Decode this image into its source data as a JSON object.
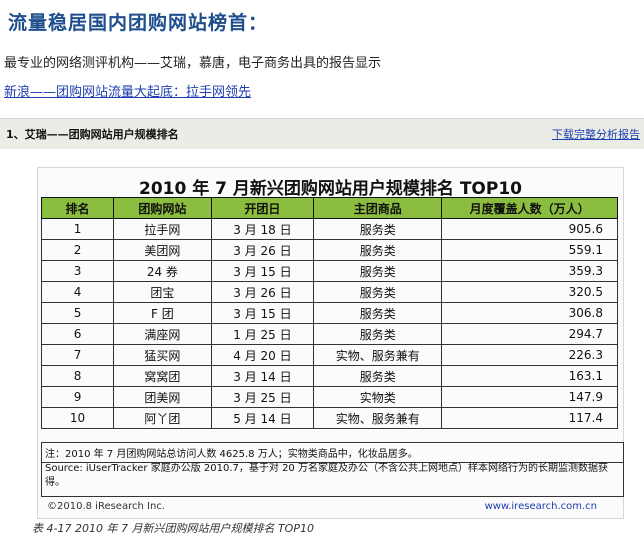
{
  "page": {
    "title": "流量稳居国内团购网站榜首：",
    "subtitle": "最专业的网络测评机构——艾瑞，慕唐，电子商务出具的报告显示",
    "link": "新浪——团购网站流量大起底：拉手网领先"
  },
  "section": {
    "title": "1、艾瑞——团购网站用户规模排名",
    "download_link": "下载完整分析报告"
  },
  "figure": {
    "title": "2010 年 7 月新兴团购网站用户规模排名 TOP10",
    "headers": [
      "排名",
      "团购网站",
      "开团日",
      "主团商品",
      "月度覆盖人数（万人）"
    ],
    "rows": [
      [
        "1",
        "拉手网",
        "3 月 18 日",
        "服务类",
        "905.6"
      ],
      [
        "2",
        "美团网",
        "3 月 26 日",
        "服务类",
        "559.1"
      ],
      [
        "3",
        "24 券",
        "3 月 15 日",
        "服务类",
        "359.3"
      ],
      [
        "4",
        "团宝",
        "3 月 26 日",
        "服务类",
        "320.5"
      ],
      [
        "5",
        "F 团",
        "3 月 15 日",
        "服务类",
        "306.8"
      ],
      [
        "6",
        "满座网",
        "1 月 25 日",
        "服务类",
        "294.7"
      ],
      [
        "7",
        "猛买网",
        "4 月 20 日",
        "实物、服务兼有",
        "226.3"
      ],
      [
        "8",
        "窝窝团",
        "3 月 14 日",
        "服务类",
        "163.1"
      ],
      [
        "9",
        "团美网",
        "3 月 25 日",
        "实物类",
        "147.9"
      ],
      [
        "10",
        "阿丫团",
        "5 月 14 日",
        "实物、服务兼有",
        "117.4"
      ]
    ],
    "note": "注：2010 年 7 月团购网站总访问人数 4625.8 万人；实物类商品中，化妆品居多。",
    "source": "Source: iUserTracker 家庭办公版 2010.7，基于对 20 万名家庭及办公（不含公共上网地点）样本网络行为的长期监测数据获得。",
    "copyright": "©2010.8 iResearch Inc.",
    "website": "www.iresearch.com.cn",
    "caption": "表 4-17 2010 年 7 月新兴团购网站用户规模排名 TOP10"
  },
  "colors": {
    "header_bg": "#8bbd3e",
    "title_color": "#1f4e8c",
    "link_color": "#1d3fb0"
  }
}
